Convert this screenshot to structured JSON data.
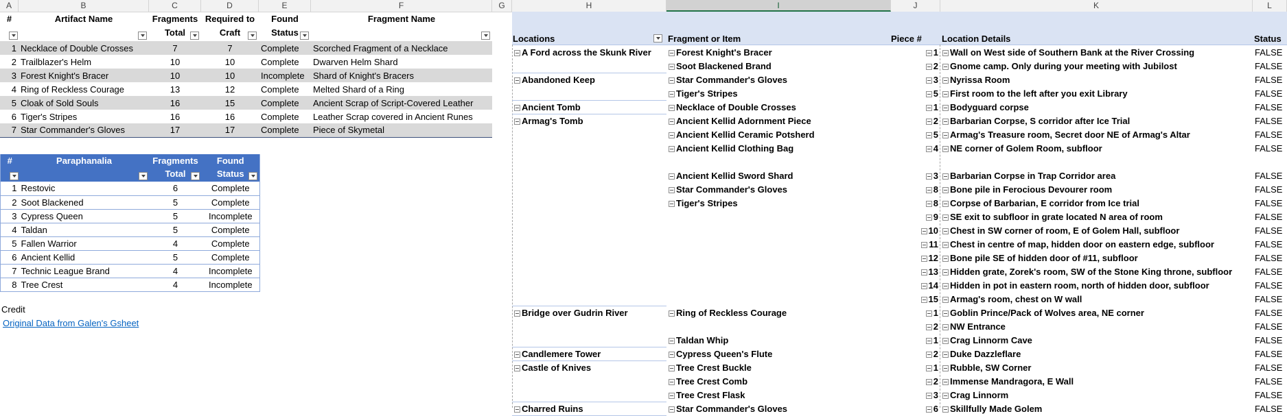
{
  "columns": [
    "A",
    "B",
    "C",
    "D",
    "E",
    "F",
    "G",
    "H",
    "I",
    "J",
    "K",
    "L"
  ],
  "artifacts": {
    "headers": {
      "num": "#",
      "name": "Artifact Name",
      "fragments": [
        "Fragments",
        "Total"
      ],
      "required": [
        "Required to",
        "Craft"
      ],
      "found": [
        "Found",
        "Status"
      ],
      "fragment_name": "Fragment Name"
    },
    "rows": [
      {
        "num": "1",
        "name": "Necklace of Double Crosses",
        "frag": "7",
        "req": "7",
        "status": "Complete",
        "fname": "Scorched Fragment of a Necklace"
      },
      {
        "num": "2",
        "name": "Trailblazer's Helm",
        "frag": "10",
        "req": "10",
        "status": "Complete",
        "fname": "Dwarven Helm Shard"
      },
      {
        "num": "3",
        "name": "Forest Knight's Bracer",
        "frag": "10",
        "req": "10",
        "status": "Incomplete",
        "fname": "Shard of Knight's Bracers"
      },
      {
        "num": "4",
        "name": "Ring of Reckless Courage",
        "frag": "13",
        "req": "12",
        "status": "Complete",
        "fname": "Melted Shard of a Ring"
      },
      {
        "num": "5",
        "name": "Cloak of Sold Souls",
        "frag": "16",
        "req": "15",
        "status": "Complete",
        "fname": "Ancient Scrap of Script-Covered Leather"
      },
      {
        "num": "6",
        "name": "Tiger's Stripes",
        "frag": "16",
        "req": "16",
        "status": "Complete",
        "fname": "Leather Scrap covered in Ancient Runes"
      },
      {
        "num": "7",
        "name": "Star Commander's Gloves",
        "frag": "17",
        "req": "17",
        "status": "Complete",
        "fname": "Piece of Skymetal"
      }
    ]
  },
  "paraphanalia": {
    "headers": {
      "num": "#",
      "name": "Paraphanalia",
      "fragments": [
        "Fragments",
        "Total"
      ],
      "found": [
        "Found",
        "Status"
      ]
    },
    "rows": [
      {
        "num": "1",
        "name": "Restovic",
        "frag": "6",
        "status": "Complete"
      },
      {
        "num": "2",
        "name": "Soot Blackened",
        "frag": "5",
        "status": "Complete"
      },
      {
        "num": "3",
        "name": "Cypress Queen",
        "frag": "5",
        "status": "Incomplete"
      },
      {
        "num": "4",
        "name": "Taldan",
        "frag": "5",
        "status": "Complete"
      },
      {
        "num": "5",
        "name": "Fallen Warrior",
        "frag": "4",
        "status": "Complete"
      },
      {
        "num": "6",
        "name": "Ancient Kellid",
        "frag": "5",
        "status": "Complete"
      },
      {
        "num": "7",
        "name": "Technic League Brand",
        "frag": "4",
        "status": "Incomplete"
      },
      {
        "num": "8",
        "name": "Tree Crest",
        "frag": "4",
        "status": "Incomplete"
      }
    ]
  },
  "credit": {
    "label": "Credit",
    "link": "Original Data from Galen's Gsheet"
  },
  "pivot": {
    "headers": {
      "locations": "Locations",
      "fragment": "Fragment or Item",
      "piece": "Piece #",
      "details": "Location Details",
      "status": "Status"
    },
    "rows": [
      {
        "loc": "A Ford across the Skunk River",
        "item": "Forest Knight's Bracer",
        "piece": "1",
        "detail": "Wall on West side of Southern Bank at the River Crossing",
        "status": "FALSE"
      },
      {
        "loc": "",
        "item": "Soot Blackened Brand",
        "piece": "2",
        "detail": "Gnome camp. Only during your meeting with Jubilost",
        "status": "FALSE"
      },
      {
        "loc": "Abandoned Keep",
        "item": "Star Commander's Gloves",
        "piece": "3",
        "detail": "Nyrissa Room",
        "status": "FALSE"
      },
      {
        "loc": "",
        "item": "Tiger's Stripes",
        "piece": "5",
        "detail": "First room to the left after you exit Library",
        "status": "FALSE"
      },
      {
        "loc": "Ancient Tomb",
        "item": "Necklace of Double Crosses",
        "piece": "1",
        "detail": "Bodyguard corpse",
        "status": "FALSE"
      },
      {
        "loc": "Armag's Tomb",
        "item": "Ancient Kellid Adornment Piece",
        "piece": "2",
        "detail": "Barbarian Corpse, S corridor after Ice Trial",
        "status": "FALSE"
      },
      {
        "loc": "",
        "item": "Ancient Kellid Ceramic Potsherd",
        "piece": "5",
        "detail": "Armag's Treasure room, Secret door NE of Armag's Altar",
        "status": "FALSE"
      },
      {
        "loc": "",
        "item": "Ancient Kellid Clothing Bag",
        "piece": "4",
        "detail": "NE corner of Golem Room, subfloor",
        "status": "FALSE"
      },
      {
        "loc": "",
        "item": "",
        "piece": "",
        "detail": "",
        "status": ""
      },
      {
        "loc": "",
        "item": "Ancient Kellid Sword Shard",
        "piece": "3",
        "detail": "Barbarian Corpse in Trap Corridor area",
        "status": "FALSE"
      },
      {
        "loc": "",
        "item": "Star Commander's Gloves",
        "piece": "8",
        "detail": "Bone pile in Ferocious Devourer room",
        "status": "FALSE"
      },
      {
        "loc": "",
        "item": "Tiger's Stripes",
        "piece": "8",
        "detail": "Corpse of Barbarian, E corridor from Ice trial",
        "status": "FALSE"
      },
      {
        "loc": "",
        "item": "",
        "piece": "9",
        "detail": "SE exit to subfloor in grate located N area of room",
        "status": "FALSE"
      },
      {
        "loc": "",
        "item": "",
        "piece": "10",
        "detail": "Chest in SW corner of room, E of Golem Hall, subfloor",
        "status": "FALSE"
      },
      {
        "loc": "",
        "item": "",
        "piece": "11",
        "detail": "Chest in centre of map, hidden door on eastern edge, subfloor",
        "status": "FALSE"
      },
      {
        "loc": "",
        "item": "",
        "piece": "12",
        "detail": "Bone pile SE of hidden door of #11, subfloor",
        "status": "FALSE"
      },
      {
        "loc": "",
        "item": "",
        "piece": "13",
        "detail": "Hidden grate, Zorek's room, SW of the Stone King throne, subfloor",
        "status": "FALSE"
      },
      {
        "loc": "",
        "item": "",
        "piece": "14",
        "detail": "Hidden in pot in eastern room, north of hidden door, subfloor",
        "status": "FALSE"
      },
      {
        "loc": "",
        "item": "",
        "piece": "15",
        "detail": "Armag's room, chest on W wall",
        "status": "FALSE"
      },
      {
        "loc": "Bridge over Gudrin River",
        "item": "Ring of Reckless Courage",
        "piece": "1",
        "detail": "Goblin Prince/Pack of Wolves area, NE corner",
        "status": "FALSE"
      },
      {
        "loc": "",
        "item": "",
        "piece": "2",
        "detail": "NW Entrance",
        "status": "FALSE"
      },
      {
        "loc": "",
        "item": "Taldan Whip",
        "piece": "1",
        "detail": "Crag Linnorm Cave",
        "status": "FALSE"
      },
      {
        "loc": "Candlemere Tower",
        "item": "Cypress Queen's Flute",
        "piece": "2",
        "detail": "Duke Dazzleflare",
        "status": "FALSE"
      },
      {
        "loc": "Castle of Knives",
        "item": "Tree Crest Buckle",
        "piece": "1",
        "detail": "Rubble, SW Corner",
        "status": "FALSE"
      },
      {
        "loc": "",
        "item": "Tree Crest Comb",
        "piece": "2",
        "detail": "Immense Mandragora, E Wall",
        "status": "FALSE"
      },
      {
        "loc": "",
        "item": "Tree Crest Flask",
        "piece": "3",
        "detail": "Crag Linnorm",
        "status": "FALSE"
      },
      {
        "loc": "Charred Ruins",
        "item": "Star Commander's Gloves",
        "piece": "6",
        "detail": "Skillfully Made Golem",
        "status": "FALSE"
      }
    ]
  }
}
